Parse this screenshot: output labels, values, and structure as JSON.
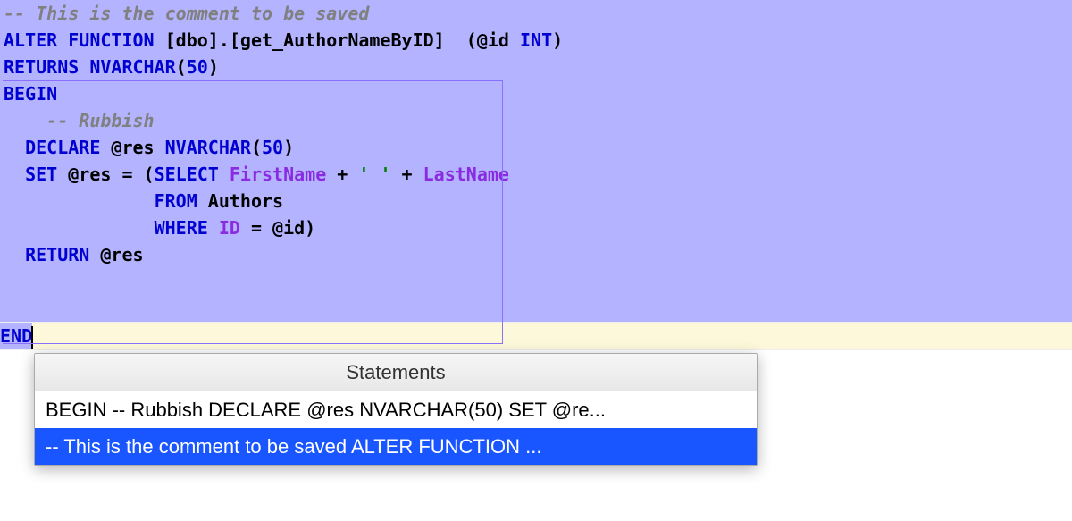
{
  "code": {
    "line1_comment": "-- This is the comment to be saved",
    "line2": {
      "kw_alter": "ALTER",
      "kw_func": "FUNCTION",
      "funcname": " [dbo].[get_AuthorNameByID] ",
      "paren_open": " (",
      "param": "@id ",
      "type": "INT",
      "paren_close": ")"
    },
    "line3": {
      "kw_returns": "RETURNS",
      "type": " NVARCHAR",
      "paren": "(",
      "num": "50",
      "paren2": ")"
    },
    "line4_begin": "BEGIN",
    "line5_comment": "    -- Rubbish",
    "line6": {
      "indent": "  ",
      "kw_declare": "DECLARE",
      "var": " @res ",
      "type": "NVARCHAR",
      "paren": "(",
      "num": "50",
      "paren2": ")"
    },
    "line7": {
      "indent": "  ",
      "kw_set": "SET",
      "var": " @res ",
      "eq": "= (",
      "kw_select": "SELECT",
      "col1": " FirstName ",
      "plus1": "+ ",
      "str": "' '",
      "plus2": " + ",
      "col2": "LastName"
    },
    "line8": {
      "indent": "              ",
      "kw_from": "FROM",
      "table": " Authors"
    },
    "line9": {
      "indent": "              ",
      "kw_where": "WHERE",
      "col": " ID ",
      "eq": "= @id)"
    },
    "line10": {
      "indent": "  ",
      "kw_return": "RETURN",
      "var": " @res"
    },
    "line_end": "END"
  },
  "popup": {
    "header": "Statements",
    "items": [
      "BEGIN -- Rubbish DECLARE @res NVARCHAR(50) SET @re...",
      "-- This is the comment to be saved ALTER FUNCTION ..."
    ]
  }
}
